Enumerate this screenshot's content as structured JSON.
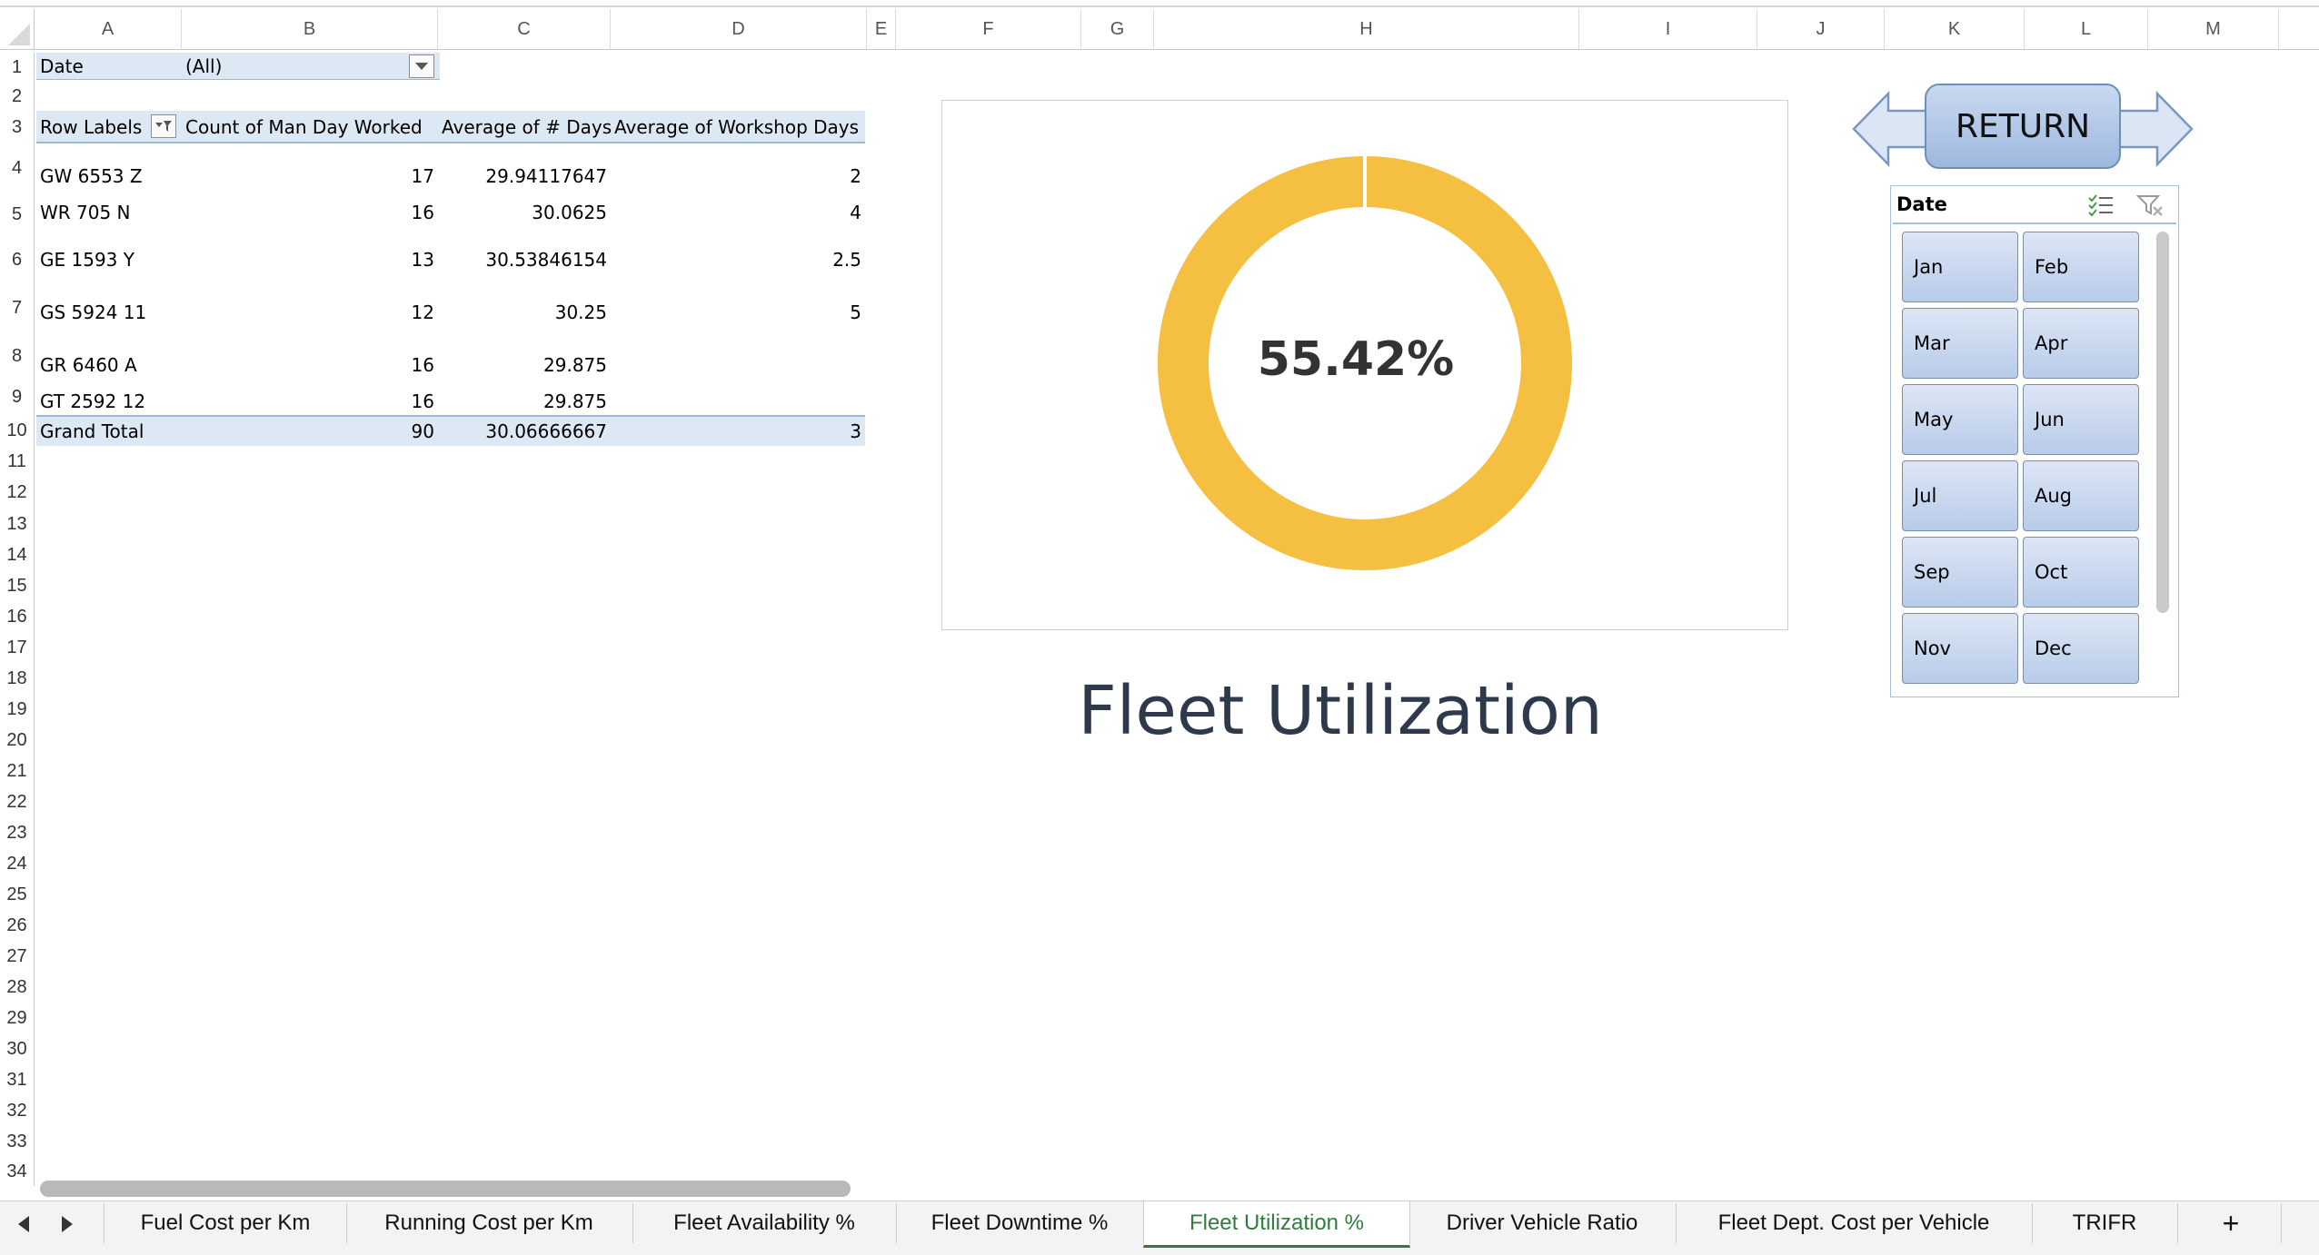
{
  "columns": [
    "A",
    "B",
    "C",
    "D",
    "E",
    "F",
    "G",
    "H",
    "I",
    "J",
    "K",
    "L",
    "M"
  ],
  "rows": [
    "1",
    "2",
    "3",
    "4",
    "5",
    "6",
    "7",
    "8",
    "9",
    "10",
    "11",
    "12",
    "13",
    "14",
    "15",
    "16",
    "17",
    "18",
    "19",
    "20",
    "21",
    "22",
    "23",
    "24",
    "25",
    "26",
    "27",
    "28",
    "29",
    "30",
    "31",
    "32",
    "33",
    "34"
  ],
  "pivot": {
    "filter_label": "Date",
    "filter_value": "(All)",
    "headers": [
      "Row Labels",
      "Count of Man Day Worked",
      "Average of # Days",
      "Average of Workshop Days"
    ],
    "rows": [
      {
        "label": "GW 6553 Z",
        "count": "17",
        "avg_days": "29.94117647",
        "avg_workshop": "2"
      },
      {
        "label": "WR 705 N",
        "count": "16",
        "avg_days": "30.0625",
        "avg_workshop": "4"
      },
      {
        "label": "GE 1593 Y",
        "count": "13",
        "avg_days": "30.53846154",
        "avg_workshop": "2.5"
      },
      {
        "label": "GS 5924 11",
        "count": "12",
        "avg_days": "30.25",
        "avg_workshop": "5"
      },
      {
        "label": "GR 6460 A",
        "count": "16",
        "avg_days": "29.875",
        "avg_workshop": ""
      },
      {
        "label": "GT 2592 12",
        "count": "16",
        "avg_days": "29.875",
        "avg_workshop": ""
      }
    ],
    "total": {
      "label": "Grand Total",
      "count": "90",
      "avg_days": "30.06666667",
      "avg_workshop": "3"
    }
  },
  "chart_data": {
    "type": "pie",
    "variant": "doughnut",
    "center_label": "55.42%",
    "values": [
      100
    ],
    "color": "#f5bf42",
    "title": "Fleet Utilization"
  },
  "return_button": {
    "label": "RETURN"
  },
  "slicer": {
    "title": "Date",
    "items": [
      "Jan",
      "Feb",
      "Mar",
      "Apr",
      "May",
      "Jun",
      "Jul",
      "Aug",
      "Sep",
      "Oct",
      "Nov",
      "Dec"
    ]
  },
  "tabs": [
    {
      "label": "Fuel Cost per Km"
    },
    {
      "label": "Running Cost per Km"
    },
    {
      "label": "Fleet Availability %"
    },
    {
      "label": "Fleet Downtime %"
    },
    {
      "label": "Fleet Utilization %",
      "active": true
    },
    {
      "label": "Driver Vehicle Ratio"
    },
    {
      "label": "Fleet Dept. Cost per Vehicle"
    },
    {
      "label": "TRIFR"
    }
  ],
  "add_sheet_label": "+",
  "colors": {
    "accent": "#2f7c3f",
    "donut": "#f5bf42",
    "pivot_band": "#dde8f5"
  }
}
